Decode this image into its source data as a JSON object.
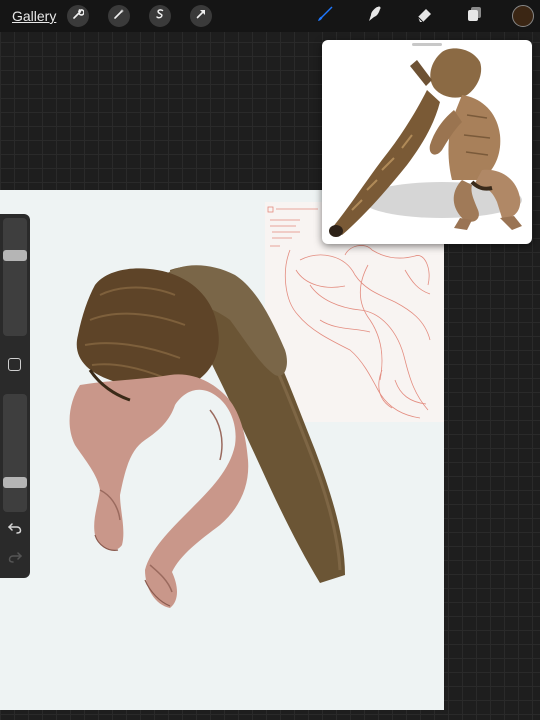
{
  "header": {
    "gallery_label": "Gallery"
  },
  "toolbar": {
    "left_tools": [
      "wrench-icon",
      "magic-wand-icon",
      "selection-icon",
      "transform-arrow-icon"
    ],
    "right_tools": [
      "brush-icon",
      "smudge-icon",
      "eraser-icon",
      "layers-icon"
    ],
    "active_tool": "brush",
    "accent_color": "#1e78ff",
    "current_color": "#3b2614"
  },
  "sidebar": {
    "brush_size_level": 0.7,
    "opacity_level": 0.22
  },
  "canvas": {
    "background_color": "#eef3f3"
  }
}
